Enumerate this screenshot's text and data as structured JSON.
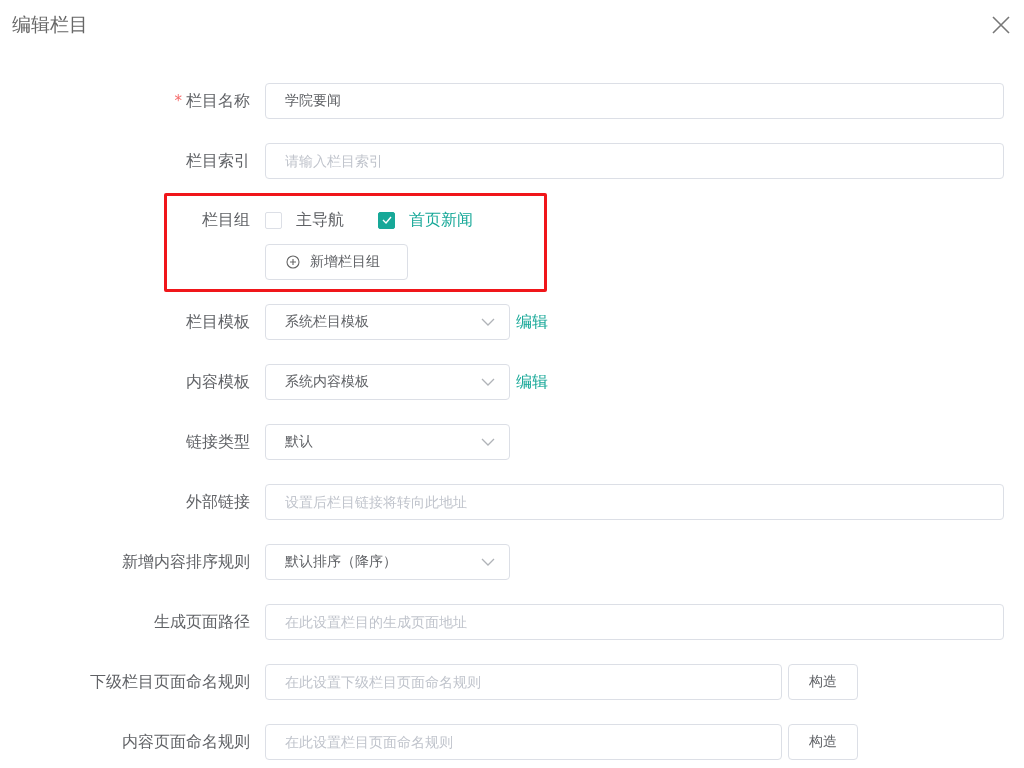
{
  "dialog": {
    "title": "编辑栏目"
  },
  "rows": [
    {
      "kind": "text",
      "label": "栏目名称",
      "required_mark": "*",
      "value": "学院要闻"
    },
    {
      "kind": "text",
      "label": "栏目索引",
      "placeholder": "请输入栏目索引"
    },
    {
      "kind": "checkgroup",
      "label": "栏目组",
      "highlighted": true,
      "options": [
        {
          "label": "主导航",
          "checked": false
        },
        {
          "label": "首页新闻",
          "checked": true
        }
      ],
      "add_button": "新增栏目组"
    },
    {
      "kind": "select",
      "label": "栏目模板",
      "value": "系统栏目模板",
      "link": "编辑"
    },
    {
      "kind": "select",
      "label": "内容模板",
      "value": "系统内容模板",
      "link": "编辑"
    },
    {
      "kind": "select",
      "label": "链接类型",
      "value": "默认"
    },
    {
      "kind": "text",
      "label": "外部链接",
      "placeholder": "设置后栏目链接将转向此地址"
    },
    {
      "kind": "select",
      "label": "新增内容排序规则",
      "value": "默认排序（降序）"
    },
    {
      "kind": "text",
      "label": "生成页面路径",
      "placeholder": "在此设置栏目的生成页面地址"
    },
    {
      "kind": "textbutton",
      "label": "下级栏目页面命名规则",
      "placeholder": "在此设置下级栏目页面命名规则",
      "button": "构造"
    },
    {
      "kind": "textbutton",
      "label": "内容页面命名规则",
      "placeholder": "在此设置栏目页面命名规则",
      "button": "构造"
    }
  ]
}
